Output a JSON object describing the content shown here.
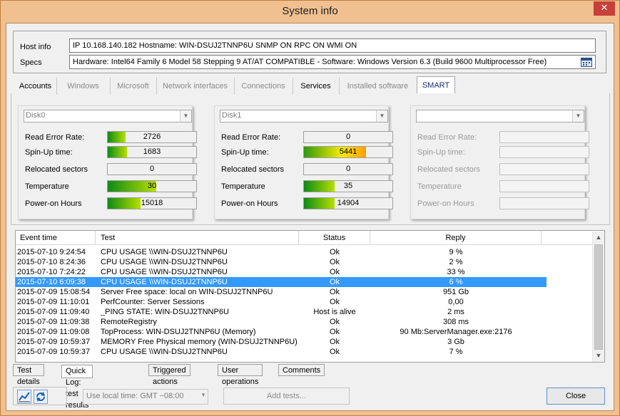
{
  "window": {
    "title": "System info",
    "close_glyph": "✕"
  },
  "host": {
    "hostinfo_label": "Host info",
    "hostinfo_value": "IP 10.168.140.182  Hostname: WIN-DSUJ2TNNP6U   SNMP ON    RPC ON    WMI ON",
    "specs_label": "Specs",
    "specs_value": "Hardware: Intel64 Family 6 Model 58 Stepping 9 AT/AT COMPATIBLE - Software: Windows Version 6.3 (Build 9600 Multiprocessor Free)",
    "specs_icon": "calendar-icon"
  },
  "tabs": [
    {
      "label": "Accounts",
      "state": "normal"
    },
    {
      "label": "Windows",
      "state": "gray"
    },
    {
      "label": "Microsoft",
      "state": "gray"
    },
    {
      "label": "Network interfaces",
      "state": "gray"
    },
    {
      "label": "Connections",
      "state": "gray"
    },
    {
      "label": "Services",
      "state": "normal"
    },
    {
      "label": "Installed software",
      "state": "gray"
    },
    {
      "label": "SMART",
      "state": "active"
    }
  ],
  "metric_labels": [
    "Read Error Rate:",
    "Spin-Up time:",
    "Relocated sectors",
    "Temperature",
    "Power-on Hours"
  ],
  "disks": [
    {
      "name": "Disk0",
      "metrics": [
        {
          "value": "2726",
          "fill": 0.2,
          "warn": false
        },
        {
          "value": "1683",
          "fill": 0.22,
          "warn": false
        },
        {
          "value": "0",
          "fill": 0,
          "warn": false
        },
        {
          "value": "30",
          "fill": 0.55,
          "warn": false
        },
        {
          "value": "15018",
          "fill": 0.37,
          "warn": false
        }
      ]
    },
    {
      "name": "Disk1",
      "metrics": [
        {
          "value": "0",
          "fill": 0,
          "warn": false
        },
        {
          "value": "5441",
          "fill": 0.7,
          "warn": true
        },
        {
          "value": "0",
          "fill": 0,
          "warn": false
        },
        {
          "value": "35",
          "fill": 0.35,
          "warn": false
        },
        {
          "value": "14904",
          "fill": 0.35,
          "warn": false
        }
      ]
    },
    {
      "name": "",
      "metrics": [
        {
          "value": "",
          "fill": 0,
          "warn": false
        },
        {
          "value": "",
          "fill": 0,
          "warn": false
        },
        {
          "value": "",
          "fill": 0,
          "warn": false
        },
        {
          "value": "",
          "fill": 0,
          "warn": false
        },
        {
          "value": "",
          "fill": 0,
          "warn": false
        }
      ]
    }
  ],
  "log": {
    "columns": [
      "Event time",
      "Test",
      "Status",
      "Reply"
    ],
    "rows": [
      {
        "time": "2015-07-10 9:24:54",
        "test": "CPU USAGE \\\\WIN-DSUJ2TNNP6U",
        "status": "Ok",
        "reply": "9 %"
      },
      {
        "time": "2015-07-10 8:24:36",
        "test": "CPU USAGE \\\\WIN-DSUJ2TNNP6U",
        "status": "Ok",
        "reply": "2 %"
      },
      {
        "time": "2015-07-10 7:24:22",
        "test": "CPU USAGE \\\\WIN-DSUJ2TNNP6U",
        "status": "Ok",
        "reply": "33 %"
      },
      {
        "time": "2015-07-10 6:09:38",
        "test": "CPU USAGE \\\\WIN-DSUJ2TNNP6U",
        "status": "Ok",
        "reply": "6 %"
      },
      {
        "time": "2015-07-09 15:08:54",
        "test": "Server Free space: local on WIN-DSUJ2TNNP6U",
        "status": "Ok",
        "reply": "951 Gb"
      },
      {
        "time": "2015-07-09 11:10:01",
        "test": "PerfCounter: Server Sessions",
        "status": "Ok",
        "reply": "0,00"
      },
      {
        "time": "2015-07-09 11:09:40",
        "test": "_PING STATE: WIN-DSUJ2TNNP6U",
        "status": "Host is alive",
        "reply": "2 ms"
      },
      {
        "time": "2015-07-09 11:09:38",
        "test": "RemoteRegistry",
        "status": "Ok",
        "reply": "308 ms"
      },
      {
        "time": "2015-07-09 11:09:08",
        "test": "TopProcess: WIN-DSUJ2TNNP6U (Memory)",
        "status": "Ok",
        "reply": "90 Mb:ServerManager.exe:2176"
      },
      {
        "time": "2015-07-09 10:59:37",
        "test": "MEMORY Free Physical memory (WIN-DSUJ2TNNP6U)",
        "status": "Ok",
        "reply": "3 Gb"
      },
      {
        "time": "2015-07-09 10:59:37",
        "test": "CPU USAGE \\\\WIN-DSUJ2TNNP6U",
        "status": "Ok",
        "reply": "7 %"
      }
    ],
    "selected_index": 3
  },
  "bottom_tabs": [
    {
      "label": "Test details",
      "active": false
    },
    {
      "label": "Quick Log: test results",
      "active": true
    },
    {
      "label": "Triggered actions",
      "active": false
    },
    {
      "label": "User operations",
      "active": false
    },
    {
      "label": "Comments",
      "active": false
    }
  ],
  "footer": {
    "timezone": "Use local time: GMT −08:00",
    "add_tests": "Add tests...",
    "close": "Close",
    "tool_icons": [
      "chart-icon",
      "refresh-icon"
    ]
  }
}
